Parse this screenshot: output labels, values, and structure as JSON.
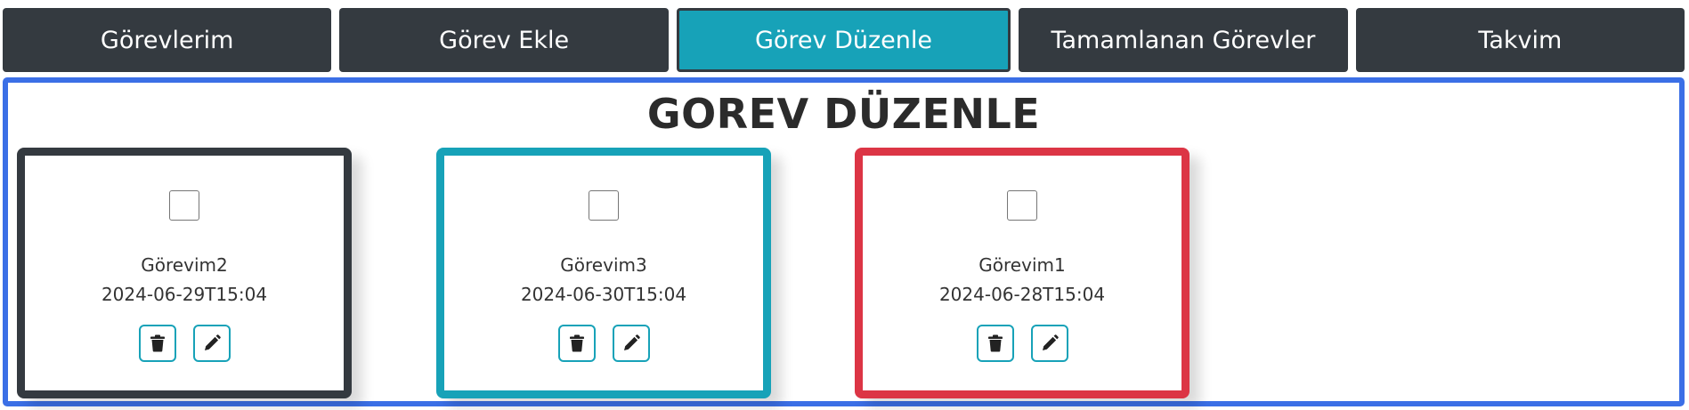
{
  "nav": {
    "items": [
      {
        "label": "Görevlerim",
        "active": false
      },
      {
        "label": "Görev Ekle",
        "active": false
      },
      {
        "label": "Görev Düzenle",
        "active": true
      },
      {
        "label": "Tamamlanan Görevler",
        "active": false
      },
      {
        "label": "Takvim",
        "active": false
      }
    ]
  },
  "main": {
    "title": "GOREV DÜZENLE"
  },
  "tasks": [
    {
      "name": "Görevim2",
      "date": "2024-06-29T15:04",
      "border_color": "#343a40",
      "checked": false
    },
    {
      "name": "Görevim3",
      "date": "2024-06-30T15:04",
      "border_color": "#17a2b8",
      "checked": false
    },
    {
      "name": "Görevim1",
      "date": "2024-06-28T15:04",
      "border_color": "#dc3545",
      "checked": false
    }
  ],
  "icons": {
    "delete": "trash-icon",
    "edit": "pencil-icon"
  },
  "colors": {
    "nav_bg": "#343a40",
    "accent": "#17a2b8",
    "panel_border": "#3b6fe6",
    "danger": "#dc3545"
  }
}
